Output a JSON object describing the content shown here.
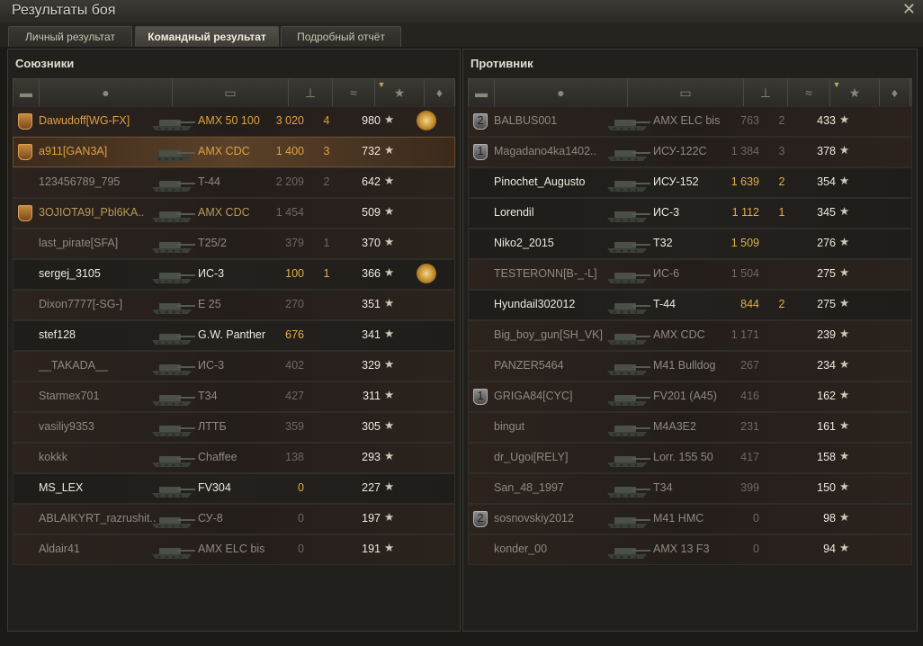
{
  "window": {
    "title": "Результаты боя"
  },
  "tabs": [
    {
      "label": "Личный результат"
    },
    {
      "label": "Командный результат"
    },
    {
      "label": "Подробный отчёт"
    }
  ],
  "colors": {
    "platoon": "#d49a4e",
    "highlight": "#5a4128",
    "gold_text": "#e0a144"
  },
  "allies": {
    "title": "Союзники",
    "rows": [
      {
        "name": "Dawudoff[WG-FX]",
        "tank": "AMX 50 100",
        "damage": "3 020",
        "kills": "4",
        "xp": "980",
        "platoon": true,
        "platoon_num": "",
        "medal": true,
        "style": "gold",
        "hl": false
      },
      {
        "name": "a911[GAN3A]",
        "tank": "AMX CDC",
        "damage": "1 400",
        "kills": "3",
        "xp": "732",
        "platoon": true,
        "platoon_num": "",
        "medal": false,
        "style": "gold",
        "hl": true
      },
      {
        "name": "123456789_795",
        "tank": "T-44",
        "damage": "2 209",
        "kills": "2",
        "xp": "642",
        "platoon": false,
        "medal": false,
        "style": "dead",
        "hl": false
      },
      {
        "name": "3OJIOTA9I_Pbl6KA..",
        "tank": "AMX CDC",
        "damage": "1 454",
        "kills": "",
        "xp": "509",
        "platoon": true,
        "platoon_num": "",
        "medal": false,
        "style": "golddead",
        "hl": false
      },
      {
        "name": "last_pirate[SFA]",
        "tank": "T25/2",
        "damage": "379",
        "kills": "1",
        "xp": "370",
        "platoon": false,
        "medal": false,
        "style": "dead",
        "hl": false
      },
      {
        "name": "sergej_3105",
        "tank": "ИС-3",
        "damage": "100",
        "kills": "1",
        "xp": "366",
        "platoon": false,
        "medal": true,
        "style": "alive",
        "hl": false
      },
      {
        "name": "Dixon7777[-SG-]",
        "tank": "E 25",
        "damage": "270",
        "kills": "",
        "xp": "351",
        "platoon": false,
        "medal": false,
        "style": "dead",
        "hl": false
      },
      {
        "name": "stef128",
        "tank": "G.W. Panther",
        "damage": "676",
        "kills": "",
        "xp": "341",
        "platoon": false,
        "medal": false,
        "style": "alive",
        "hl": false
      },
      {
        "name": "__TAKADA__",
        "tank": "ИС-3",
        "damage": "402",
        "kills": "",
        "xp": "329",
        "platoon": false,
        "medal": false,
        "style": "dead",
        "hl": false
      },
      {
        "name": "Starmex701",
        "tank": "T34",
        "damage": "427",
        "kills": "",
        "xp": "311",
        "platoon": false,
        "medal": false,
        "style": "dead",
        "hl": false
      },
      {
        "name": "vasiliy9353",
        "tank": "ЛТТБ",
        "damage": "359",
        "kills": "",
        "xp": "305",
        "platoon": false,
        "medal": false,
        "style": "dead",
        "hl": false
      },
      {
        "name": "kokkk",
        "tank": "Chaffee",
        "damage": "138",
        "kills": "",
        "xp": "293",
        "platoon": false,
        "medal": false,
        "style": "dead",
        "hl": false
      },
      {
        "name": "MS_LEX",
        "tank": "FV304",
        "damage": "0",
        "kills": "",
        "xp": "227",
        "platoon": false,
        "medal": false,
        "style": "alive",
        "hl": false
      },
      {
        "name": "ABLAIKYRT_razrushit..",
        "tank": "СУ-8",
        "damage": "0",
        "kills": "",
        "xp": "197",
        "platoon": false,
        "medal": false,
        "style": "dead",
        "hl": false
      },
      {
        "name": "Aldair41",
        "tank": "AMX ELC bis",
        "damage": "0",
        "kills": "",
        "xp": "191",
        "platoon": false,
        "medal": false,
        "style": "dead",
        "hl": false
      }
    ]
  },
  "enemies": {
    "title": "Противник",
    "rows": [
      {
        "name": "BALBUS001",
        "tank": "AMX ELC bis",
        "damage": "763",
        "kills": "2",
        "xp": "433",
        "platoon": true,
        "platoon_num": "2",
        "grey": true,
        "medal": false,
        "style": "dead",
        "hl": false
      },
      {
        "name": "Magadano4ka1402..",
        "tank": "ИСУ-122С",
        "damage": "1 384",
        "kills": "3",
        "xp": "378",
        "platoon": true,
        "platoon_num": "1",
        "grey": true,
        "medal": false,
        "style": "dead",
        "hl": false
      },
      {
        "name": "Pinochet_Augusto",
        "tank": "ИСУ-152",
        "damage": "1 639",
        "kills": "2",
        "xp": "354",
        "platoon": false,
        "medal": false,
        "style": "alive",
        "hl": false
      },
      {
        "name": "Lorendil",
        "tank": "ИС-3",
        "damage": "1 112",
        "kills": "1",
        "xp": "345",
        "platoon": false,
        "medal": false,
        "style": "alive",
        "hl": false
      },
      {
        "name": "Niko2_2015",
        "tank": "T32",
        "damage": "1 509",
        "kills": "",
        "xp": "276",
        "platoon": false,
        "medal": false,
        "style": "alive",
        "hl": false
      },
      {
        "name": "TESTERONN[B-_-L]",
        "tank": "ИС-6",
        "damage": "1 504",
        "kills": "",
        "xp": "275",
        "platoon": false,
        "medal": false,
        "style": "dead",
        "hl": false
      },
      {
        "name": "Hyundail302012",
        "tank": "T-44",
        "damage": "844",
        "kills": "2",
        "xp": "275",
        "platoon": false,
        "medal": false,
        "style": "alive",
        "hl": false
      },
      {
        "name": "Big_boy_gun[SH_VK]",
        "tank": "AMX CDC",
        "damage": "1 171",
        "kills": "",
        "xp": "239",
        "platoon": false,
        "medal": false,
        "style": "dead",
        "hl": false
      },
      {
        "name": "PANZER5464",
        "tank": "M41 Bulldog",
        "damage": "267",
        "kills": "",
        "xp": "234",
        "platoon": false,
        "medal": false,
        "style": "dead",
        "hl": false
      },
      {
        "name": "GRIGA84[CYC]",
        "tank": "FV201 (A45)",
        "damage": "416",
        "kills": "",
        "xp": "162",
        "platoon": true,
        "platoon_num": "1",
        "grey": true,
        "medal": false,
        "style": "dead",
        "hl": false
      },
      {
        "name": "bingut",
        "tank": "M4A3E2",
        "damage": "231",
        "kills": "",
        "xp": "161",
        "platoon": false,
        "medal": false,
        "style": "dead",
        "hl": false
      },
      {
        "name": "dr_Ugoi[RELY]",
        "tank": "Lorr. 155 50",
        "damage": "417",
        "kills": "",
        "xp": "158",
        "platoon": false,
        "medal": false,
        "style": "dead",
        "hl": false
      },
      {
        "name": "San_48_1997",
        "tank": "T34",
        "damage": "399",
        "kills": "",
        "xp": "150",
        "platoon": false,
        "medal": false,
        "style": "dead",
        "hl": false
      },
      {
        "name": "sosnovskiy2012",
        "tank": "M41 HMC",
        "damage": "0",
        "kills": "",
        "xp": "98",
        "platoon": true,
        "platoon_num": "2",
        "grey": true,
        "medal": false,
        "style": "dead",
        "hl": false
      },
      {
        "name": "konder_00",
        "tank": "AMX 13 F3",
        "damage": "0",
        "kills": "",
        "xp": "94",
        "platoon": false,
        "medal": false,
        "style": "dead",
        "hl": false
      }
    ]
  },
  "star_glyph": "★",
  "icons": [
    "close-icon",
    "platoon-icon",
    "player-icon",
    "tank-icon",
    "damage-icon",
    "kills-icon",
    "xp-icon",
    "medal-icon",
    "sort-arrow-icon"
  ]
}
